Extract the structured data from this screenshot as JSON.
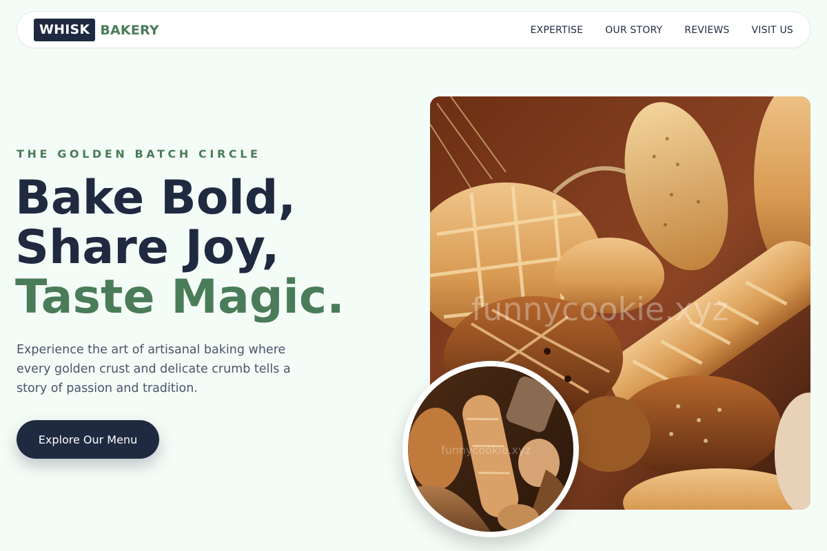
{
  "brand": {
    "box_text": "WHISK",
    "text": "BAKERY"
  },
  "nav": {
    "links": [
      {
        "label": "EXPERTISE"
      },
      {
        "label": "OUR STORY"
      },
      {
        "label": "REVIEWS"
      },
      {
        "label": "VISIT US"
      }
    ]
  },
  "hero": {
    "eyebrow": "THE GOLDEN BATCH CIRCLE",
    "headline_line1": "Bake Bold,",
    "headline_line2": "Share Joy,",
    "headline_line3": "Taste Magic.",
    "description": "Experience the art of artisanal baking where every golden crust and delicate crumb tells a story of passion and tradition.",
    "cta_label": "Explore Our Menu"
  },
  "images": {
    "main_watermark": "funnycookie.xyz",
    "circle_watermark": "funnycookie.xyz"
  },
  "colors": {
    "background": "#f4fcf7",
    "navy": "#1f2a40",
    "accent_green": "#4a7c59",
    "body_text": "#4a5568"
  }
}
